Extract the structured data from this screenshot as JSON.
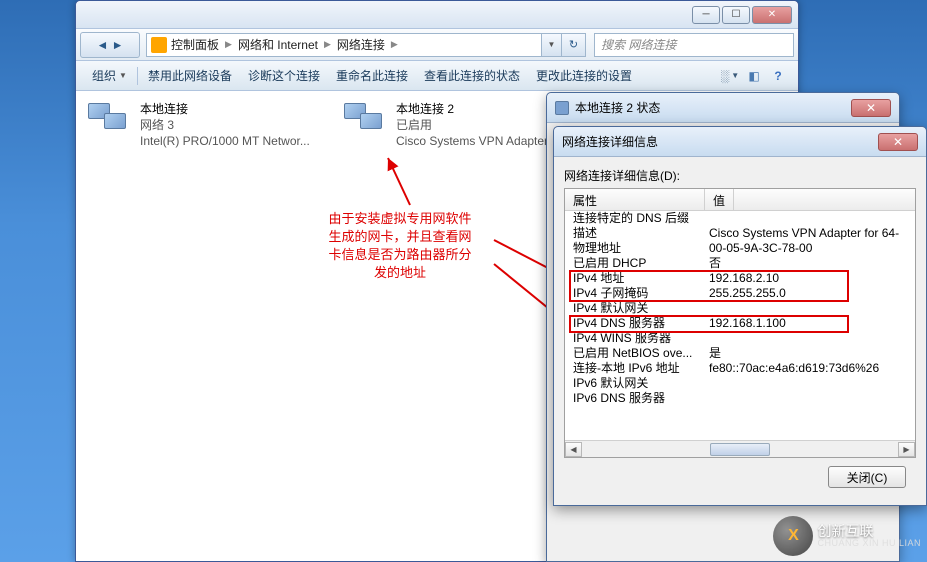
{
  "titlebar": {
    "minimize": "─",
    "maximize": "☐",
    "close": "✕"
  },
  "breadcrumb": {
    "items": [
      "控制面板",
      "网络和 Internet",
      "网络连接"
    ]
  },
  "searchbox": {
    "placeholder": "搜索 网络连接"
  },
  "toolbar": {
    "organize": "组织",
    "disable": "禁用此网络设备",
    "diagnose": "诊断这个连接",
    "rename": "重命名此连接",
    "status": "查看此连接的状态",
    "settings": "更改此连接的设置"
  },
  "connections": [
    {
      "name": "本地连接",
      "line2": "网络  3",
      "line3": "Intel(R) PRO/1000 MT Networ..."
    },
    {
      "name": "本地连接 2",
      "line2": "已启用",
      "line3": "Cisco Systems VPN Adapter fo..."
    }
  ],
  "annotation": {
    "text1": "由于安装虚拟专用网软件",
    "text2": "生成的网卡，并且查看网",
    "text3": "卡信息是否为路由器所分",
    "text4": "发的地址"
  },
  "dialog1": {
    "title": "本地连接 2 状态",
    "close": "✕"
  },
  "dialog2": {
    "title": "网络连接详细信息",
    "close": "✕",
    "label": "网络连接详细信息(D):",
    "col1": "属性",
    "col2": "值",
    "rows": [
      {
        "k": "连接特定的 DNS 后缀",
        "v": ""
      },
      {
        "k": "描述",
        "v": "Cisco Systems VPN Adapter for 64-"
      },
      {
        "k": "物理地址",
        "v": "00-05-9A-3C-78-00"
      },
      {
        "k": "已启用 DHCP",
        "v": "否"
      },
      {
        "k": "IPv4 地址",
        "v": "192.168.2.10"
      },
      {
        "k": "IPv4 子网掩码",
        "v": "255.255.255.0"
      },
      {
        "k": "IPv4 默认网关",
        "v": ""
      },
      {
        "k": "IPv4 DNS 服务器",
        "v": "192.168.1.100"
      },
      {
        "k": "IPv4 WINS 服务器",
        "v": ""
      },
      {
        "k": "已启用 NetBIOS ove...",
        "v": "是"
      },
      {
        "k": "连接-本地 IPv6 地址",
        "v": "fe80::70ac:e4a6:d619:73d6%26"
      },
      {
        "k": "IPv6 默认网关",
        "v": ""
      },
      {
        "k": "IPv6 DNS 服务器",
        "v": ""
      }
    ],
    "close_btn": "关闭(C)"
  },
  "watermark": {
    "brand": "创新互联",
    "sub": "CHUANG XIN HU LIAN",
    "logo": "X"
  }
}
